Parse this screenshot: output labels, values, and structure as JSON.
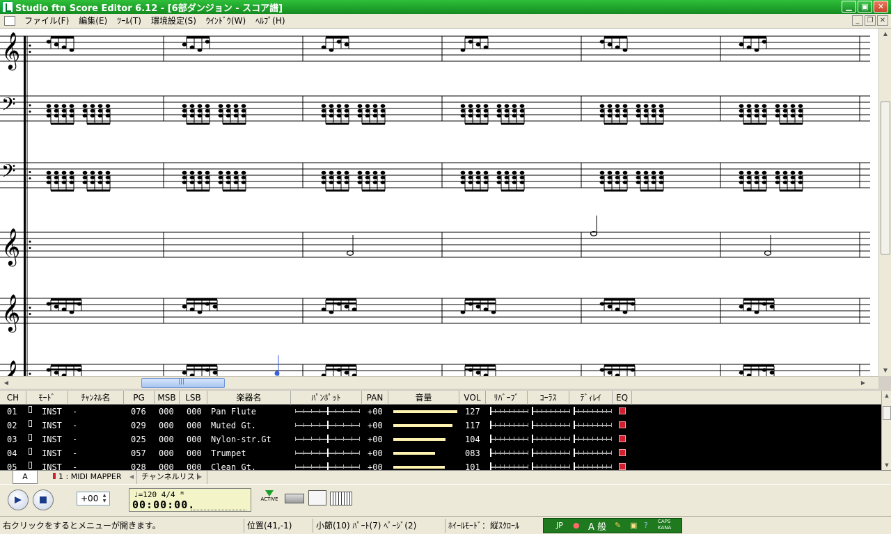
{
  "window": {
    "title": "Studio ftn Score Editor 6.12 - [6部ダンジョン - スコア譜]",
    "controls": [
      "minimize",
      "maximize",
      "close"
    ]
  },
  "menu": {
    "items": [
      "ファイル(F)",
      "編集(E)",
      "ﾂｰﾙ(T)",
      "環境設定(S)",
      "ｳｲﾝﾄﾞｳ(W)",
      "ﾍﾙﾌﾟ(H)"
    ]
  },
  "score": {
    "staves": [
      {
        "clef": "treble",
        "key": "g-clef-icon"
      },
      {
        "clef": "bass",
        "key": "f-clef-icon"
      },
      {
        "clef": "bass",
        "key": "f-clef-icon"
      },
      {
        "clef": "treble",
        "key": "g-clef-icon"
      },
      {
        "clef": "treble",
        "key": "g-clef-icon"
      },
      {
        "clef": "treble",
        "key": "g-clef-icon"
      }
    ]
  },
  "channel_panel": {
    "headers": [
      "CH",
      "ﾓｰﾄﾞ",
      "ﾁｬﾝﾈﾙ名",
      "PG",
      "MSB",
      "LSB",
      "楽器名",
      "ﾊﾟﾝﾎﾟｯﾄ",
      "PAN",
      "音量",
      "VOL",
      "ﾘﾊﾞｰﾌﾞ",
      "ｺｰﾗｽ",
      "ﾃﾞｨﾚｲ",
      "EQ"
    ],
    "rows": [
      {
        "ch": "01",
        "mode": "INST",
        "name": "-",
        "pg": "076",
        "msb": "000",
        "lsb": "000",
        "inst": "Pan Flute",
        "pan": "+00",
        "vol": "127",
        "vol_level": 1.0
      },
      {
        "ch": "02",
        "mode": "INST",
        "name": "-",
        "pg": "029",
        "msb": "000",
        "lsb": "000",
        "inst": "Muted Gt.",
        "pan": "+00",
        "vol": "117",
        "vol_level": 0.92
      },
      {
        "ch": "03",
        "mode": "INST",
        "name": "-",
        "pg": "025",
        "msb": "000",
        "lsb": "000",
        "inst": "Nylon-str.Gt",
        "pan": "+00",
        "vol": "104",
        "vol_level": 0.82
      },
      {
        "ch": "04",
        "mode": "INST",
        "name": "-",
        "pg": "057",
        "msb": "000",
        "lsb": "000",
        "inst": "Trumpet",
        "pan": "+00",
        "vol": "083",
        "vol_level": 0.65
      },
      {
        "ch": "05",
        "mode": "INST",
        "name": "-",
        "pg": "028",
        "msb": "000",
        "lsb": "000",
        "inst": "Clean Gt.",
        "pan": "+00",
        "vol": "101",
        "vol_level": 0.8
      }
    ]
  },
  "tabs": {
    "active": "A",
    "midi": "1 : MIDI MAPPER",
    "channel_list": "チャンネルリスト"
  },
  "transport": {
    "transpose": "+00",
    "lcd_line1": "♩=120  4/4   ᴹ",
    "lcd_time": "00:00:00.",
    "active_label": "ACTIVE"
  },
  "status": {
    "hint": "右クリックをするとメニューが開きます。",
    "position": "位置(41,-1)",
    "location": "小節(10) ﾊﾟｰﾄ(7) ﾍﾟｰｼﾞ(2)",
    "wheel_mode": "ﾎｲｰﾙﾓｰﾄﾞ：縦ｽｸﾛｰﾙ",
    "ime_lang": "JP",
    "ime_mode": "A 般",
    "caps": "CAPS",
    "kana": "KANA"
  },
  "colors": {
    "titlebar": "#1a9c2a",
    "eq_box": "#d02030",
    "vol_bar": "#fff3b0",
    "lcd": "#f3f5c8"
  }
}
